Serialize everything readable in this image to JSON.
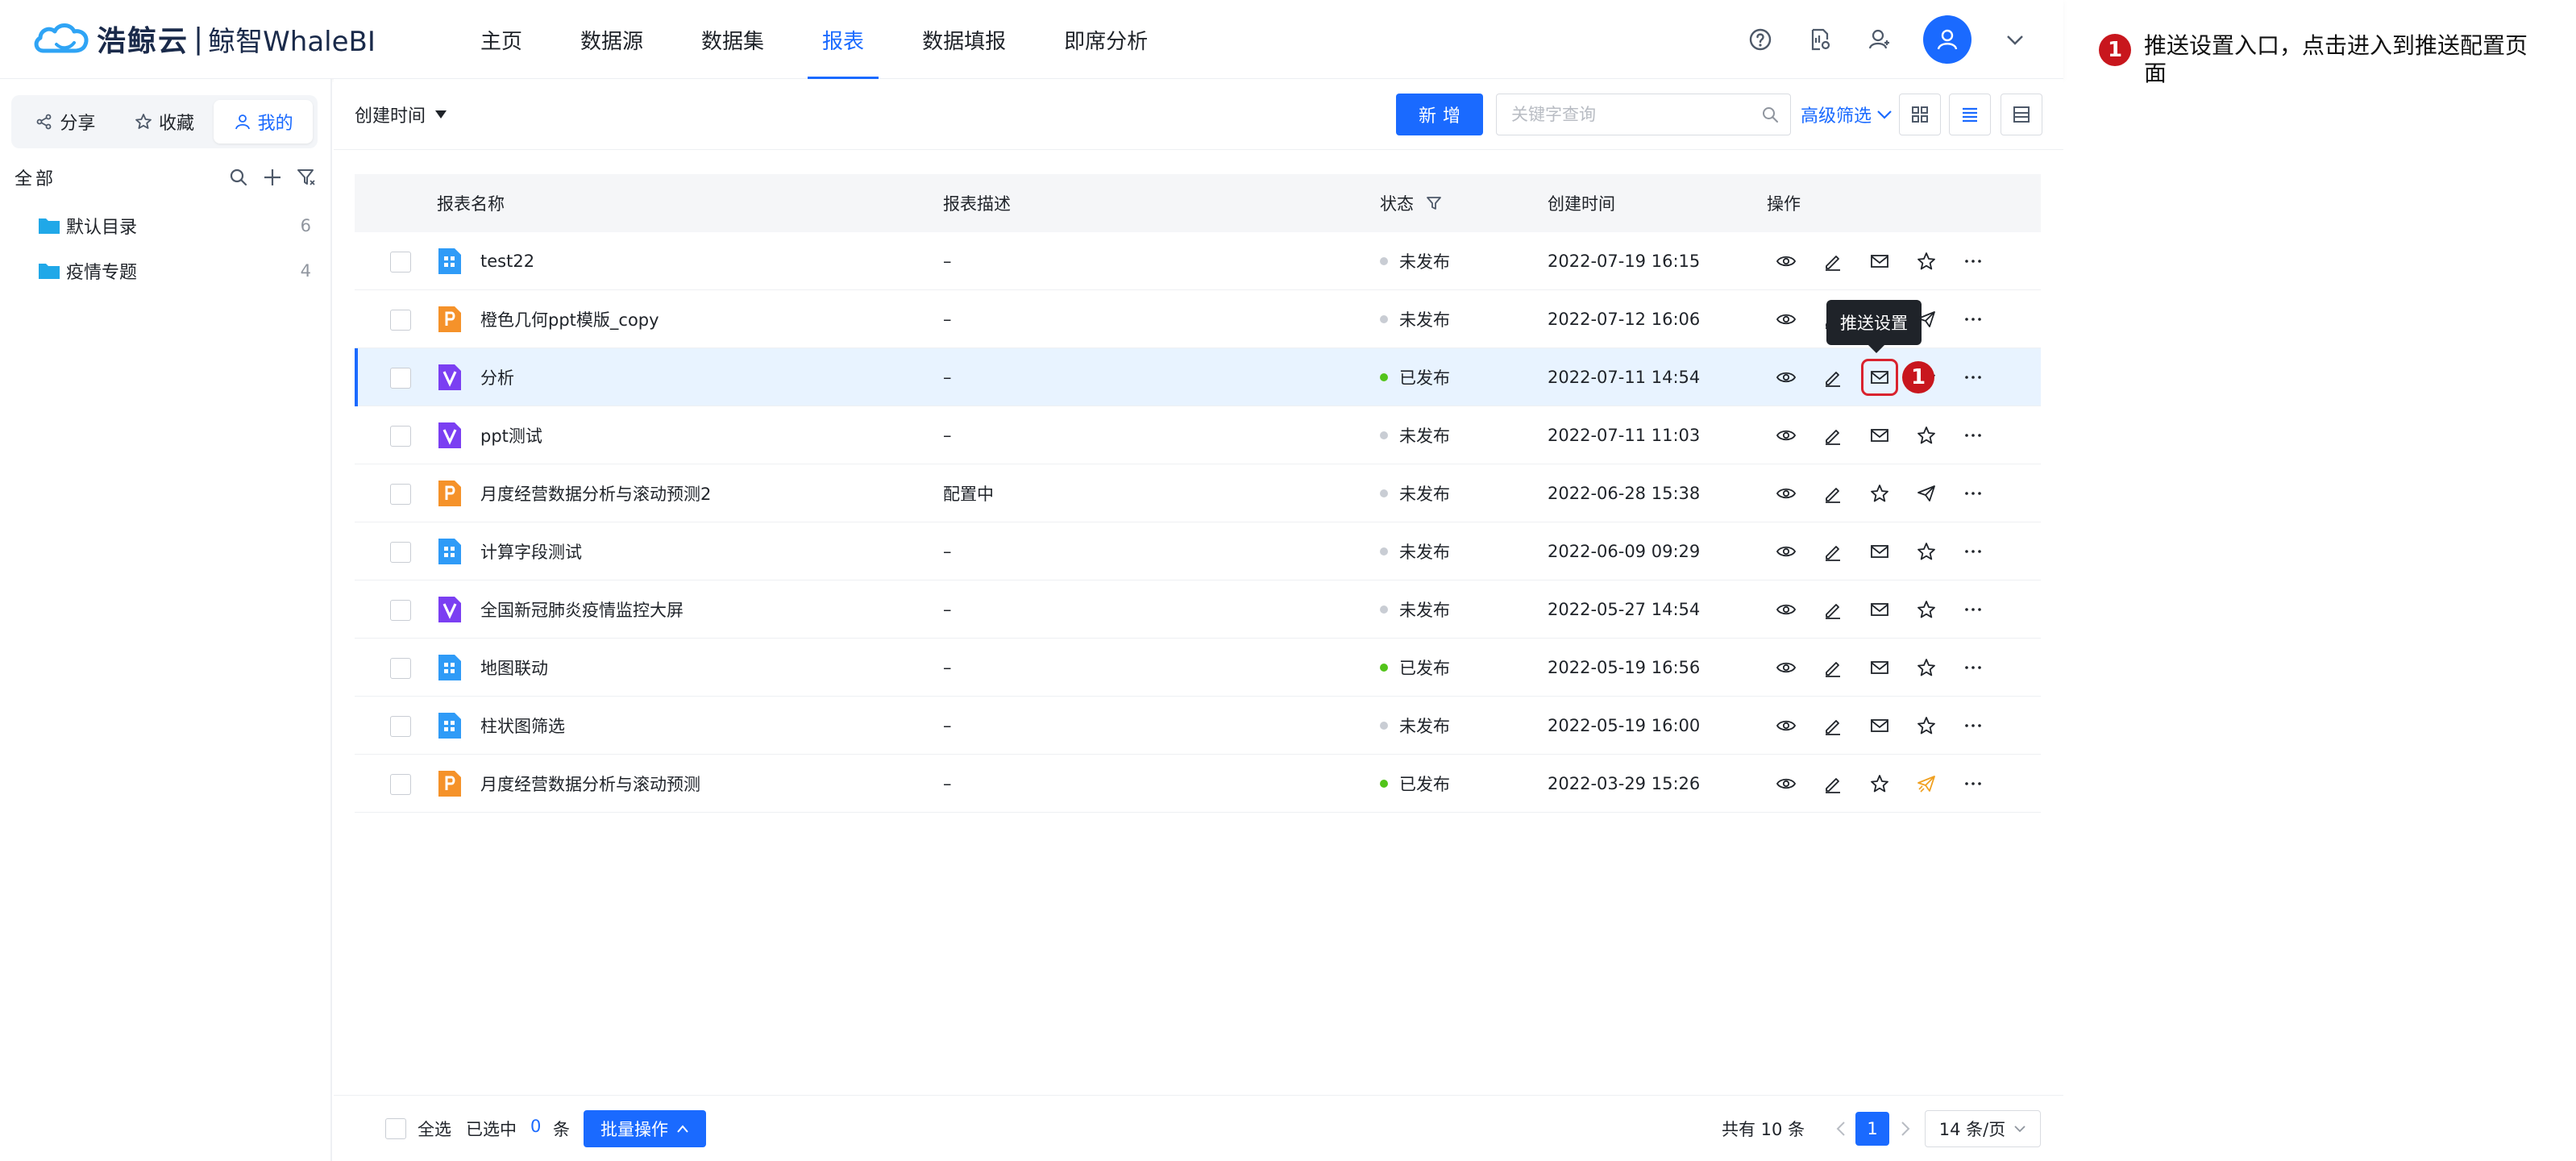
{
  "brand": {
    "name": "浩鲸云",
    "separator": "|",
    "product": "鲸智WhaleBI"
  },
  "nav": [
    {
      "label": "主页"
    },
    {
      "label": "数据源"
    },
    {
      "label": "数据集"
    },
    {
      "label": "报表",
      "active": true
    },
    {
      "label": "数据填报"
    },
    {
      "label": "即席分析"
    }
  ],
  "header_icons": [
    "help-icon",
    "report-settings-icon",
    "user-manage-icon",
    "avatar-icon",
    "chevron-down-icon"
  ],
  "sidebar": {
    "tabs": [
      {
        "label": "分享",
        "icon": "share-icon"
      },
      {
        "label": "收藏",
        "icon": "star-icon"
      },
      {
        "label": "我的",
        "icon": "user-icon",
        "active": true
      }
    ],
    "tree_label": "全部",
    "folders": [
      {
        "name": "默认目录",
        "count": "6"
      },
      {
        "name": "疫情专题",
        "count": "4"
      }
    ]
  },
  "toolbar": {
    "sort_label": "创建时间",
    "add_label": "新增",
    "search_placeholder": "关键字查询",
    "advanced_filter": "高级筛选"
  },
  "table": {
    "columns": {
      "name": "报表名称",
      "desc": "报表描述",
      "status": "状态",
      "created": "创建时间",
      "ops": "操作"
    },
    "rows": [
      {
        "type": "dashboard",
        "name": "test22",
        "desc": "–",
        "status": "未发布",
        "published": false,
        "created": "2022-07-19 16:15",
        "ops": [
          "view",
          "edit",
          "mail",
          "star",
          "more"
        ]
      },
      {
        "type": "ppt",
        "name": "橙色几何ppt模版_copy",
        "desc": "–",
        "status": "未发布",
        "published": false,
        "created": "2022-07-12 16:06",
        "ops": [
          "view",
          "edit",
          "mail",
          "send",
          "more"
        ]
      },
      {
        "type": "screen",
        "name": "分析",
        "desc": "–",
        "status": "已发布",
        "published": true,
        "created": "2022-07-11 14:54",
        "ops": [
          "view",
          "edit",
          "mail",
          "star",
          "more"
        ],
        "selected": true
      },
      {
        "type": "screen",
        "name": "ppt测试",
        "desc": "–",
        "status": "未发布",
        "published": false,
        "created": "2022-07-11 11:03",
        "ops": [
          "view",
          "edit",
          "mail",
          "star",
          "more"
        ]
      },
      {
        "type": "ppt",
        "name": "月度经营数据分析与滚动预测2",
        "desc": "配置中",
        "status": "未发布",
        "published": false,
        "created": "2022-06-28 15:38",
        "ops": [
          "view",
          "edit",
          "star",
          "send",
          "more"
        ]
      },
      {
        "type": "dashboard",
        "name": "计算字段测试",
        "desc": "–",
        "status": "未发布",
        "published": false,
        "created": "2022-06-09 09:29",
        "ops": [
          "view",
          "edit",
          "mail",
          "star",
          "more"
        ]
      },
      {
        "type": "screen",
        "name": "全国新冠肺炎疫情监控大屏",
        "desc": "–",
        "status": "未发布",
        "published": false,
        "created": "2022-05-27 14:54",
        "ops": [
          "view",
          "edit",
          "mail",
          "star",
          "more"
        ]
      },
      {
        "type": "dashboard",
        "name": "地图联动",
        "desc": "–",
        "status": "已发布",
        "published": true,
        "created": "2022-05-19 16:56",
        "ops": [
          "view",
          "edit",
          "mail",
          "star",
          "more"
        ]
      },
      {
        "type": "dashboard",
        "name": "柱状图筛选",
        "desc": "–",
        "status": "未发布",
        "published": false,
        "created": "2022-05-19 16:00",
        "ops": [
          "view",
          "edit",
          "mail",
          "star",
          "more"
        ]
      },
      {
        "type": "ppt",
        "name": "月度经营数据分析与滚动预测",
        "desc": "–",
        "status": "已发布",
        "published": true,
        "created": "2022-03-29 15:26",
        "ops": [
          "view",
          "edit",
          "star",
          "send-active",
          "more"
        ]
      }
    ]
  },
  "tooltip": "推送设置",
  "marker_number": "1",
  "footer": {
    "select_all": "全选",
    "selected_prefix": "已选中",
    "selected_count": "0",
    "selected_suffix": "条",
    "batch_label": "批量操作",
    "total": "共有 10 条",
    "current_page": "1",
    "page_size": "14 条/页"
  },
  "annotation": {
    "number": "1",
    "text": "推送设置入口，点击进入到推送配置页面"
  },
  "colors": {
    "accent": "#1a6aff",
    "published": "#52c41a",
    "unpublished": "#c9cdd4",
    "marker": "#c8161d",
    "dashboard_icon": "#2f9bf7",
    "ppt_icon": "#f5922a",
    "screen_icon": "#7b3ff2"
  }
}
